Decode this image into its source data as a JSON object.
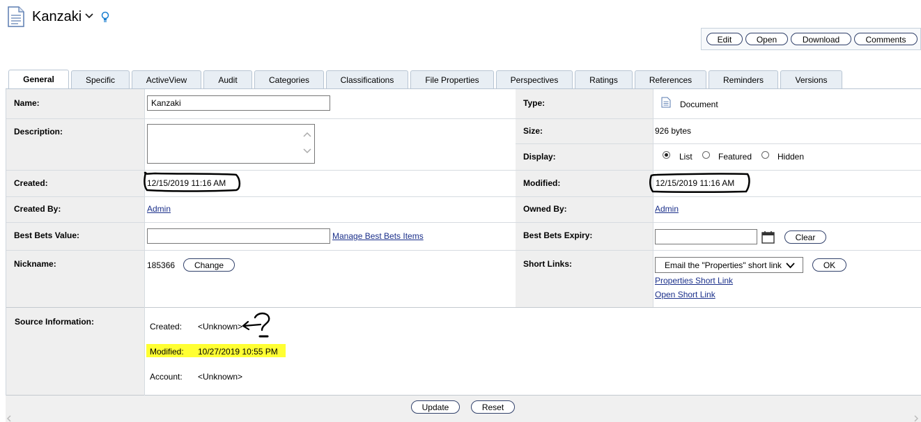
{
  "header": {
    "title": "Kanzaki",
    "actions": [
      "Edit",
      "Open",
      "Download",
      "Comments"
    ]
  },
  "tabs": [
    "General",
    "Specific",
    "ActiveView",
    "Audit",
    "Categories",
    "Classifications",
    "File Properties",
    "Perspectives",
    "Ratings",
    "References",
    "Reminders",
    "Versions"
  ],
  "active_tab": "General",
  "fields": {
    "name_label": "Name:",
    "name_value": "Kanzaki",
    "type_label": "Type:",
    "type_value": "Document",
    "description_label": "Description:",
    "size_label": "Size:",
    "size_value": "926 bytes",
    "display_label": "Display:",
    "display_options": [
      "List",
      "Featured",
      "Hidden"
    ],
    "display_selected": "List",
    "created_label": "Created:",
    "created_value": "12/15/2019 11:16 AM",
    "modified_label": "Modified:",
    "modified_value": "12/15/2019 11:16 AM",
    "created_by_label": "Created By:",
    "created_by_value": "Admin",
    "owned_by_label": "Owned By:",
    "owned_by_value": "Admin",
    "best_bets_label": "Best Bets Value:",
    "manage_best_bets": "Manage Best Bets Items",
    "best_bets_expiry_label": "Best Bets Expiry:",
    "clear_label": "Clear",
    "nickname_label": "Nickname:",
    "nickname_value": "185366",
    "change_label": "Change",
    "short_links_label": "Short Links:",
    "short_links_select": "Email the \"Properties\" short link",
    "ok_label": "OK",
    "properties_short_link": "Properties Short Link",
    "open_short_link": "Open Short Link"
  },
  "source": {
    "label": "Source Information:",
    "created_label": "Created:",
    "created_value": "<Unknown>",
    "modified_label": "Modified:",
    "modified_value": "10/27/2019 10:55 PM",
    "account_label": "Account:",
    "account_value": "<Unknown>"
  },
  "footer": {
    "update_label": "Update",
    "reset_label": "Reset"
  },
  "colors": {
    "highlight": "#ffff33",
    "link": "#1a2f8a",
    "label_bg": "#efefef"
  }
}
